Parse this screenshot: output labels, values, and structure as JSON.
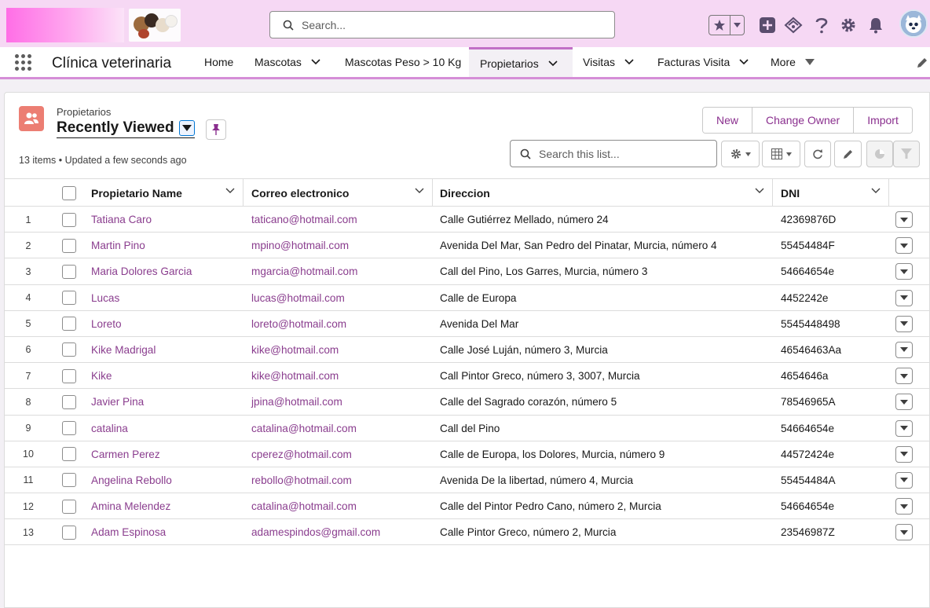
{
  "header": {
    "search_placeholder": "Search..."
  },
  "nav": {
    "app_name": "Clínica veterinaria",
    "items": [
      {
        "label": "Home"
      },
      {
        "label": "Mascotas"
      },
      {
        "label": "Mascotas Peso > 10 Kg"
      },
      {
        "label": "Propietarios"
      },
      {
        "label": "Visitas"
      },
      {
        "label": "Facturas Visita"
      },
      {
        "label": "More"
      }
    ]
  },
  "list_view": {
    "object_label": "Propietarios",
    "list_name": "Recently Viewed",
    "meta": "13 items • Updated a few seconds ago",
    "buttons": {
      "new": "New",
      "change_owner": "Change Owner",
      "import": "Import"
    },
    "search_placeholder": "Search this list..."
  },
  "table": {
    "columns": [
      "Propietario Name",
      "Correo electronico",
      "Direccion",
      "DNI"
    ],
    "rows": [
      {
        "num": "1",
        "name": "Tatiana Caro",
        "email": "taticano@hotmail.com",
        "address": "Calle Gutiérrez Mellado, número 24",
        "dni": "42369876D"
      },
      {
        "num": "2",
        "name": "Martin Pino",
        "email": "mpino@hotmail.com",
        "address": "Avenida Del Mar, San Pedro del Pinatar, Murcia, número 4",
        "dni": "55454484F"
      },
      {
        "num": "3",
        "name": "Maria Dolores Garcia",
        "email": "mgarcia@hotmail.com",
        "address": "Call del Pino, Los Garres, Murcia, número 3",
        "dni": "54664654e"
      },
      {
        "num": "4",
        "name": "Lucas",
        "email": "lucas@hotmail.com",
        "address": "Calle de Europa",
        "dni": "4452242e"
      },
      {
        "num": "5",
        "name": "Loreto",
        "email": "loreto@hotmail.com",
        "address": "Avenida Del Mar",
        "dni": "5545448498"
      },
      {
        "num": "6",
        "name": "Kike Madrigal",
        "email": "kike@hotmail.com",
        "address": "Calle José Luján, número 3, Murcia",
        "dni": "46546463Aa"
      },
      {
        "num": "7",
        "name": "Kike",
        "email": "kike@hotmail.com",
        "address": "Call Pintor Greco, número 3, 3007, Murcia",
        "dni": "4654646a"
      },
      {
        "num": "8",
        "name": "Javier Pina",
        "email": "jpina@hotmail.com",
        "address": "Calle del Sagrado corazón, número 5",
        "dni": "78546965A"
      },
      {
        "num": "9",
        "name": "catalina",
        "email": "catalina@hotmail.com",
        "address": "Call del Pino",
        "dni": "54664654e"
      },
      {
        "num": "10",
        "name": "Carmen Perez",
        "email": "cperez@hotmail.com",
        "address": "Calle de Europa, los Dolores, Murcia, número 9",
        "dni": "44572424e"
      },
      {
        "num": "11",
        "name": "Angelina Rebollo",
        "email": "rebollo@hotmail.com",
        "address": "Avenida De la libertad, número 4, Murcia",
        "dni": "55454484A"
      },
      {
        "num": "12",
        "name": "Amina Melendez",
        "email": "catalina@hotmail.com",
        "address": "Calle del Pintor Pedro Cano, número 2, Murcia",
        "dni": "54664654e"
      },
      {
        "num": "13",
        "name": "Adam Espinosa",
        "email": "adamespindos@gmail.com",
        "address": "Calle Pintor Greco, número 2, Murcia",
        "dni": "23546987Z"
      }
    ]
  },
  "colors": {
    "header_bg": "#f6d8f4",
    "nav_accent": "#d58ed7",
    "link": "#8a3d8e",
    "object_icon": "#ec7e73"
  },
  "icons": [
    "search-icon",
    "star-icon",
    "add-icon",
    "trailhead-icon",
    "help-icon",
    "gear-icon",
    "bell-icon",
    "avatar",
    "waffle-icon",
    "pencil-icon",
    "owner-icon",
    "pin-icon",
    "refresh-icon",
    "table-icon",
    "chart-icon",
    "filter-icon"
  ]
}
